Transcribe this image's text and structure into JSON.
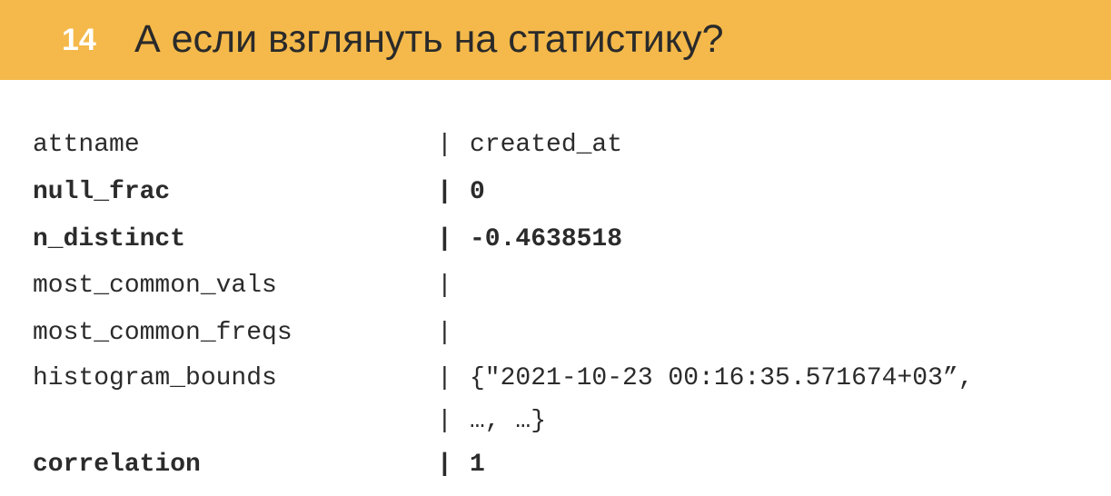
{
  "header": {
    "slide_number": "14",
    "title": "А если взглянуть на статистику?",
    "background_color": "#f4b94a"
  },
  "stats": {
    "separator": "|",
    "rows": [
      {
        "name": "attname",
        "value": "created_at",
        "bold": false
      },
      {
        "name": "null_frac",
        "value": "0",
        "bold": true
      },
      {
        "name": "n_distinct",
        "value": "-0.4638518",
        "bold": true
      },
      {
        "name": "most_common_vals",
        "value": "",
        "bold": false
      },
      {
        "name": "most_common_freqs",
        "value": "",
        "bold": false
      },
      {
        "name": "histogram_bounds",
        "value": "{\"2021-10-23 00:16:35.571674+03”,",
        "bold": false
      },
      {
        "name": "",
        "value": " …, …}",
        "bold": false
      },
      {
        "name": "correlation",
        "value": "1",
        "bold": true
      }
    ]
  }
}
